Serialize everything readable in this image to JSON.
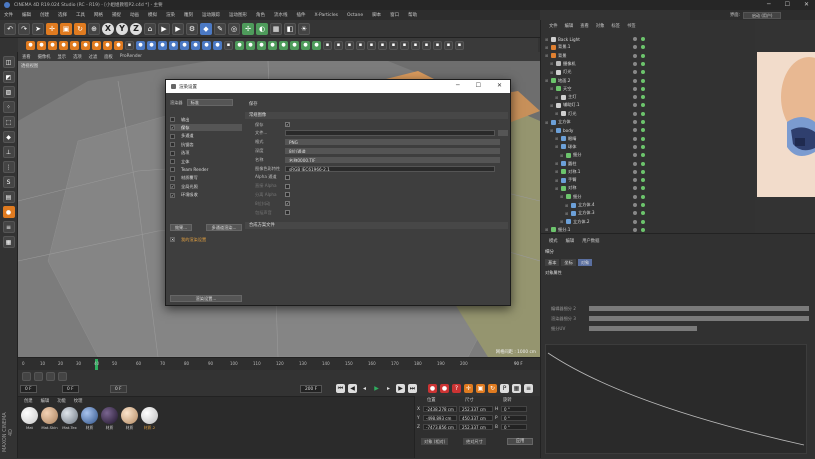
{
  "app": {
    "title": "CINEMA 4D R19.024 Studio (RC - R19) - [小姐姐教程P2.c4d *] - 主要"
  },
  "menubar": [
    "文件",
    "编辑",
    "创建",
    "选择",
    "工具",
    "网格",
    "捕捉",
    "动画",
    "模拟",
    "渲染",
    "雕刻",
    "运动跟踪",
    "运动图形",
    "角色",
    "流水线",
    "插件",
    "X-Particles",
    "Octane",
    "脚本",
    "窗口",
    "帮助"
  ],
  "interface": {
    "label": "界面:",
    "value": "启动 (用户)"
  },
  "viewport": {
    "menu": [
      "查看",
      "摄像机",
      "显示",
      "选项",
      "过滤",
      "面板",
      "ProRender"
    ],
    "label": "透视视图",
    "grid_status": "网格间距 : 1000 cm"
  },
  "timeline": {
    "ticks": [
      "0",
      "10",
      "20",
      "30",
      "40",
      "50",
      "60",
      "70",
      "80",
      "90",
      "100",
      "110",
      "120",
      "130",
      "140",
      "150",
      "160",
      "170",
      "180",
      "190",
      "200"
    ],
    "current_frame": "0 F",
    "frame_start": "0 F",
    "frame_end": "200 F",
    "frame_end2": "200 F",
    "frame_box": "0 F",
    "time_end": "90 F"
  },
  "material_manager": {
    "menu": [
      "创建",
      "编辑",
      "功能",
      "纹理"
    ],
    "materials": [
      {
        "label": "Mat",
        "color": "#f0f0f0"
      },
      {
        "label": "Mat.Skin",
        "color": "#d9b08c"
      },
      {
        "label": "Mat.Tex",
        "color": "#9aa4b0"
      },
      {
        "label": "材质",
        "color": "#5a7fb5"
      },
      {
        "label": "材质",
        "color": "#3a2a48"
      },
      {
        "label": "材质",
        "color": "#e0c0a0"
      },
      {
        "label": "材质.2",
        "color": "#eeeeee"
      }
    ]
  },
  "brand": "MAXON CINEMA 4D",
  "coordinates": {
    "headers": [
      "位置",
      "尺寸",
      "旋转"
    ],
    "rows": [
      {
        "axis": "X",
        "pos": "-2438.278 cm",
        "size": "252.337 cm",
        "rot_axis": "H",
        "rot": "0 °"
      },
      {
        "axis": "Y",
        "pos": "-498.893 cm",
        "size": "450.337 cm",
        "rot_axis": "P",
        "rot": "0 °"
      },
      {
        "axis": "Z",
        "pos": "-7473.856 cm",
        "size": "252.337 cm",
        "rot_axis": "B",
        "rot": "0 °"
      }
    ],
    "mode1": "对象 (相对)",
    "mode2": "绝对尺寸",
    "apply": "应用"
  },
  "object_manager": {
    "menu": [
      "文件",
      "编辑",
      "查看",
      "对象",
      "标签",
      "书签"
    ],
    "objects": [
      {
        "name": "Back Light",
        "indent": 0,
        "color": "#d0d0d0"
      },
      {
        "name": "背景.1",
        "indent": 0,
        "color": "#e08030"
      },
      {
        "name": "背景",
        "indent": 0,
        "color": "#e08030"
      },
      {
        "name": "摄像机",
        "indent": 1,
        "color": "#bbbbbb"
      },
      {
        "name": "灯光",
        "indent": 1,
        "color": "#d0d0d0"
      },
      {
        "name": "地面.2",
        "indent": 0,
        "color": "#6cc46c"
      },
      {
        "name": "天空",
        "indent": 1,
        "color": "#6cc46c"
      },
      {
        "name": "主灯",
        "indent": 2,
        "color": "#d0d0d0"
      },
      {
        "name": "辅助灯.1",
        "indent": 1,
        "color": "#d0d0d0"
      },
      {
        "name": "灯光",
        "indent": 2,
        "color": "#d0d0d0"
      },
      {
        "name": "立方体",
        "indent": 0,
        "color": "#6ca0d8"
      },
      {
        "name": "body",
        "indent": 1,
        "color": "#6ca0d8"
      },
      {
        "name": "眼睛",
        "indent": 2,
        "color": "#6ca0d8"
      },
      {
        "name": "球体",
        "indent": 2,
        "color": "#6ca0d8"
      },
      {
        "name": "细分",
        "indent": 3,
        "color": "#6cc46c"
      },
      {
        "name": "圆柱",
        "indent": 2,
        "color": "#6ca0d8"
      },
      {
        "name": "对称.1",
        "indent": 2,
        "color": "#6cc46c"
      },
      {
        "name": "手臂",
        "indent": 2,
        "color": "#6ca0d8"
      },
      {
        "name": "对称",
        "indent": 2,
        "color": "#6cc46c"
      },
      {
        "name": "细分",
        "indent": 3,
        "color": "#6cc46c"
      },
      {
        "name": "立方体.4",
        "indent": 4,
        "color": "#6ca0d8"
      },
      {
        "name": "立方体.3",
        "indent": 4,
        "color": "#6ca0d8"
      },
      {
        "name": "立方体.2",
        "indent": 3,
        "color": "#6ca0d8"
      },
      {
        "name": "细分.1",
        "indent": 0,
        "color": "#6cc46c"
      }
    ]
  },
  "attribute_manager": {
    "menu": [
      "模式",
      "编辑",
      "用户数据"
    ],
    "title": "细分",
    "tabs": [
      {
        "label": "基本",
        "on": false
      },
      {
        "label": "坐标",
        "on": false
      },
      {
        "label": "对象",
        "on": true
      }
    ],
    "section": "对象属性",
    "lines": [
      "编辑器细分 2",
      "渲染器细分 3",
      "细分UV"
    ]
  },
  "dialog": {
    "title": "渲染设置",
    "renderer_label": "渲染器",
    "renderer_value": "标准",
    "items": [
      {
        "label": "输出",
        "checked": false,
        "sel": false
      },
      {
        "label": "保存",
        "checked": true,
        "sel": true
      },
      {
        "label": "多通道",
        "checked": false,
        "sel": false
      },
      {
        "label": "抗锯齿",
        "checked": false,
        "sel": false
      },
      {
        "label": "选项",
        "checked": false,
        "sel": false
      },
      {
        "label": "立体",
        "checked": false,
        "sel": false
      },
      {
        "label": "Team Render",
        "checked": false,
        "sel": false
      },
      {
        "label": "材质覆写",
        "checked": false,
        "sel": false
      },
      {
        "label": "全局光照",
        "checked": true,
        "sel": false
      },
      {
        "label": "环境吸收",
        "checked": true,
        "sel": false
      }
    ],
    "effect_btn": "效果...",
    "multipass_btn": "多通道渲染...",
    "preset_item": "我的渲染设置",
    "render_settings_btn": "渲染设置...",
    "header_right": "保存",
    "section_regular": "常规图像",
    "fields": [
      {
        "label": "保存",
        "value": "✓",
        "kind": "cb"
      },
      {
        "label": "文件...",
        "value": "",
        "kind": "text"
      },
      {
        "label": "格式",
        "value": "PNG",
        "kind": "dd"
      },
      {
        "label": "深度",
        "value": "8位/通道",
        "kind": "dd"
      },
      {
        "label": "名称",
        "value": "名称0000.TIF",
        "kind": "dd"
      },
      {
        "label": "图像色彩特性",
        "value": "sRGB IEC61966-2.1",
        "kind": "text"
      },
      {
        "label": "Alpha 通道",
        "value": "",
        "kind": "cb"
      },
      {
        "label": "直接 Alpha",
        "value": "",
        "kind": "cbdim"
      },
      {
        "label": "分离 Alpha",
        "value": "",
        "kind": "cbdim"
      },
      {
        "label": "8位抖动",
        "value": "✓",
        "kind": "cbdim"
      },
      {
        "label": "包括声音",
        "value": "",
        "kind": "cbdim"
      }
    ],
    "section_composite": "合成方案文件"
  }
}
